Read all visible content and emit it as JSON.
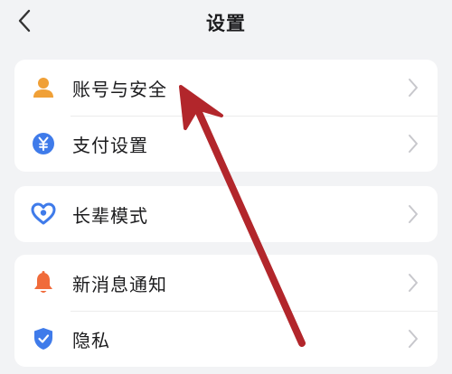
{
  "header": {
    "title": "设置"
  },
  "groups": [
    {
      "items": [
        {
          "label": "账号与安全",
          "icon": "person-icon"
        },
        {
          "label": "支付设置",
          "icon": "yuan-icon"
        }
      ]
    },
    {
      "items": [
        {
          "label": "长辈模式",
          "icon": "heart-icon"
        }
      ]
    },
    {
      "items": [
        {
          "label": "新消息通知",
          "icon": "bell-icon"
        },
        {
          "label": "隐私",
          "icon": "shield-icon"
        }
      ]
    }
  ],
  "colors": {
    "accent_orange": "#f0a037",
    "accent_blue": "#3f7bea",
    "annotation_arrow": "#b2262b"
  }
}
